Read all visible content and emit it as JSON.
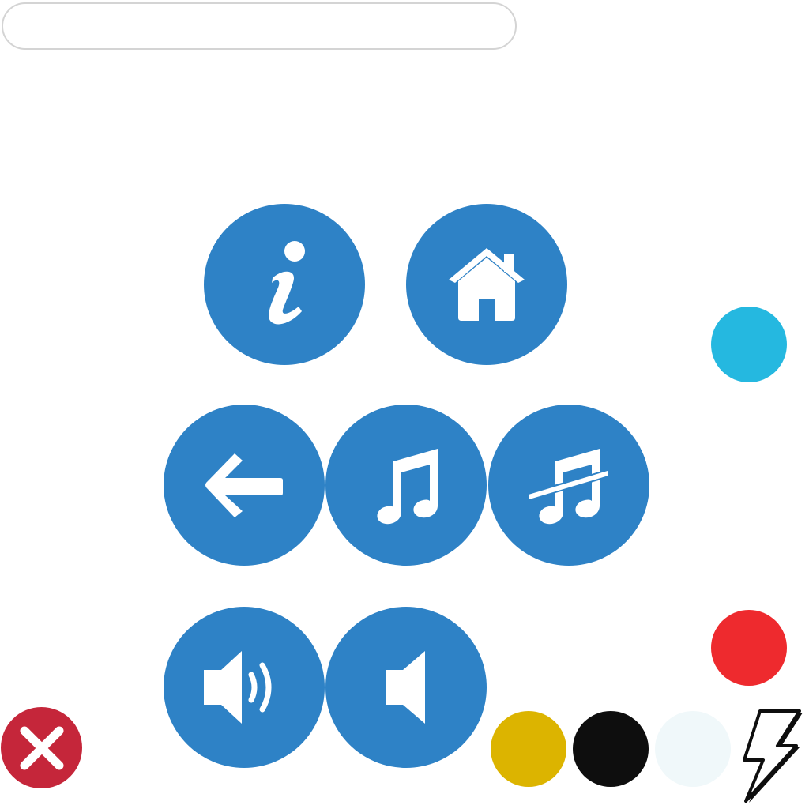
{
  "search": {
    "value": "",
    "placeholder": ""
  },
  "colors": {
    "button_blue": "#2e82c6",
    "icon_white": "#ffffff",
    "cyan_dot": "#25b8e0",
    "red_dot": "#ee2a2e",
    "close_red": "#c5263a",
    "yellow_swatch": "#dcb400",
    "black_swatch": "#0e0e0e",
    "white_swatch": "#f0f8fa",
    "search_border": "#d4d4d4"
  },
  "buttons": [
    {
      "name": "info-button",
      "icon": "info-icon"
    },
    {
      "name": "home-button",
      "icon": "home-icon"
    },
    {
      "name": "back-button",
      "icon": "arrow-left-icon"
    },
    {
      "name": "music-on-button",
      "icon": "music-note-icon"
    },
    {
      "name": "music-off-button",
      "icon": "music-note-slash-icon"
    },
    {
      "name": "sound-on-button",
      "icon": "volume-up-icon"
    },
    {
      "name": "sound-off-button",
      "icon": "volume-mute-icon"
    }
  ],
  "color_swatches": [
    "cyan",
    "red",
    "yellow",
    "black",
    "white"
  ],
  "extra_icons": [
    "close-icon",
    "lightning-bolt-icon"
  ]
}
